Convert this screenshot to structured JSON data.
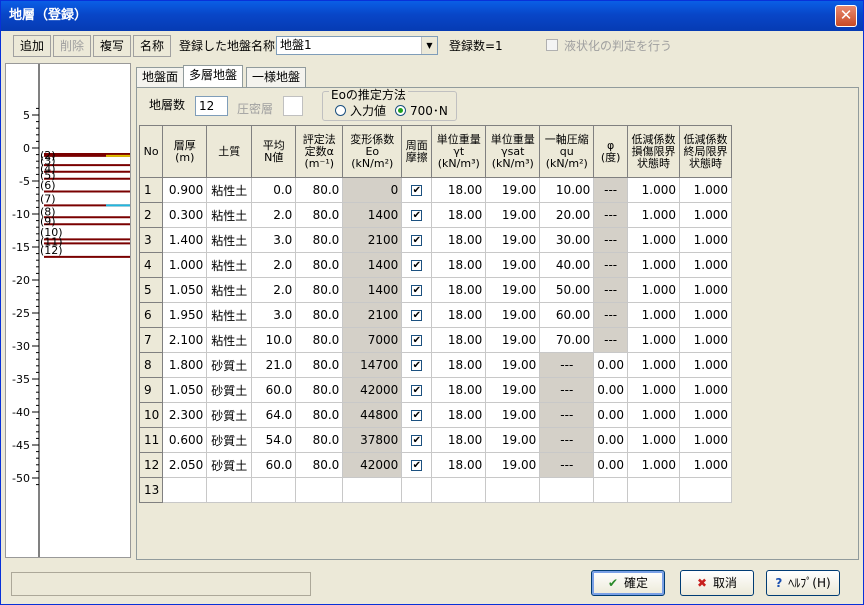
{
  "window": {
    "title": "地層（登録）",
    "close_glyph": "✕"
  },
  "toolbar": {
    "add": "追加",
    "delete": "削除",
    "copy": "複写",
    "rename": "名称",
    "ground_name_label": "登録した地盤名称",
    "ground_name_value": "地盤1",
    "count_label": "登録数=1",
    "liquefaction_label": "液状化の判定を行う"
  },
  "ruler": {
    "ticks": [
      "5",
      "0",
      "-5",
      "-10",
      "-15",
      "-20",
      "-25",
      "-30",
      "-35",
      "-40",
      "-45",
      "-50"
    ],
    "layer_labels": [
      "(2)",
      "(3)",
      "(4)",
      "(5)",
      "(6)",
      "(7)",
      "(8)",
      "(9)",
      "(10)",
      "(11)",
      "(12)"
    ]
  },
  "tabs": [
    "地盤面",
    "多層地盤",
    "一様地盤"
  ],
  "panel": {
    "layer_count_label": "地層数",
    "layer_count_value": "12",
    "compaction_label": "圧密層",
    "eo_group_label": "Eoの推定方法",
    "eo_opt1": "入力値",
    "eo_opt2": "700･N"
  },
  "grid": {
    "headers": [
      [
        "No"
      ],
      [
        "層厚",
        "(m)"
      ],
      [
        "土質"
      ],
      [
        "平均",
        "N値"
      ],
      [
        "評定法",
        "定数α",
        "(m⁻¹)"
      ],
      [
        "変形係数",
        "Eo",
        "(kN/m²)"
      ],
      [
        "周面",
        "摩擦"
      ],
      [
        "単位重量",
        "γt",
        "(kN/m³)"
      ],
      [
        "単位重量",
        "γsat",
        "(kN/m³)"
      ],
      [
        "一軸圧縮",
        "qu",
        "(kN/m²)"
      ],
      [
        "φ",
        "(度)"
      ],
      [
        "低減係数",
        "損傷限界",
        "状態時"
      ],
      [
        "低減係数",
        "終局限界",
        "状態時"
      ]
    ],
    "rows": [
      [
        "1",
        "0.900",
        "粘性土",
        "0.0",
        "80.0",
        "0",
        "✔",
        "18.00",
        "19.00",
        "10.00",
        "---",
        "1.000",
        "1.000"
      ],
      [
        "2",
        "0.300",
        "粘性土",
        "2.0",
        "80.0",
        "1400",
        "✔",
        "18.00",
        "19.00",
        "20.00",
        "---",
        "1.000",
        "1.000"
      ],
      [
        "3",
        "1.400",
        "粘性土",
        "3.0",
        "80.0",
        "2100",
        "✔",
        "18.00",
        "19.00",
        "30.00",
        "---",
        "1.000",
        "1.000"
      ],
      [
        "4",
        "1.000",
        "粘性土",
        "2.0",
        "80.0",
        "1400",
        "✔",
        "18.00",
        "19.00",
        "40.00",
        "---",
        "1.000",
        "1.000"
      ],
      [
        "5",
        "1.050",
        "粘性土",
        "2.0",
        "80.0",
        "1400",
        "✔",
        "18.00",
        "19.00",
        "50.00",
        "---",
        "1.000",
        "1.000"
      ],
      [
        "6",
        "1.950",
        "粘性土",
        "3.0",
        "80.0",
        "2100",
        "✔",
        "18.00",
        "19.00",
        "60.00",
        "---",
        "1.000",
        "1.000"
      ],
      [
        "7",
        "2.100",
        "粘性土",
        "10.0",
        "80.0",
        "7000",
        "✔",
        "18.00",
        "19.00",
        "70.00",
        "---",
        "1.000",
        "1.000"
      ],
      [
        "8",
        "1.800",
        "砂質土",
        "21.0",
        "80.0",
        "14700",
        "✔",
        "18.00",
        "19.00",
        "---",
        "0.00",
        "1.000",
        "1.000"
      ],
      [
        "9",
        "1.050",
        "砂質土",
        "60.0",
        "80.0",
        "42000",
        "✔",
        "18.00",
        "19.00",
        "---",
        "0.00",
        "1.000",
        "1.000"
      ],
      [
        "10",
        "2.300",
        "砂質土",
        "64.0",
        "80.0",
        "44800",
        "✔",
        "18.00",
        "19.00",
        "---",
        "0.00",
        "1.000",
        "1.000"
      ],
      [
        "11",
        "0.600",
        "砂質土",
        "54.0",
        "80.0",
        "37800",
        "✔",
        "18.00",
        "19.00",
        "---",
        "0.00",
        "1.000",
        "1.000"
      ],
      [
        "12",
        "2.050",
        "砂質土",
        "60.0",
        "80.0",
        "42000",
        "✔",
        "18.00",
        "19.00",
        "---",
        "0.00",
        "1.000",
        "1.000"
      ],
      [
        "13",
        "",
        "",
        "",
        "",
        "",
        "",
        "",
        "",
        "",
        "",
        "",
        ""
      ]
    ]
  },
  "footer": {
    "ok": "確定",
    "cancel": "取消",
    "help": "ﾍﾙﾌﾟ(H)",
    "ok_icon": "✔",
    "cancel_icon": "✖",
    "help_icon": "?"
  }
}
